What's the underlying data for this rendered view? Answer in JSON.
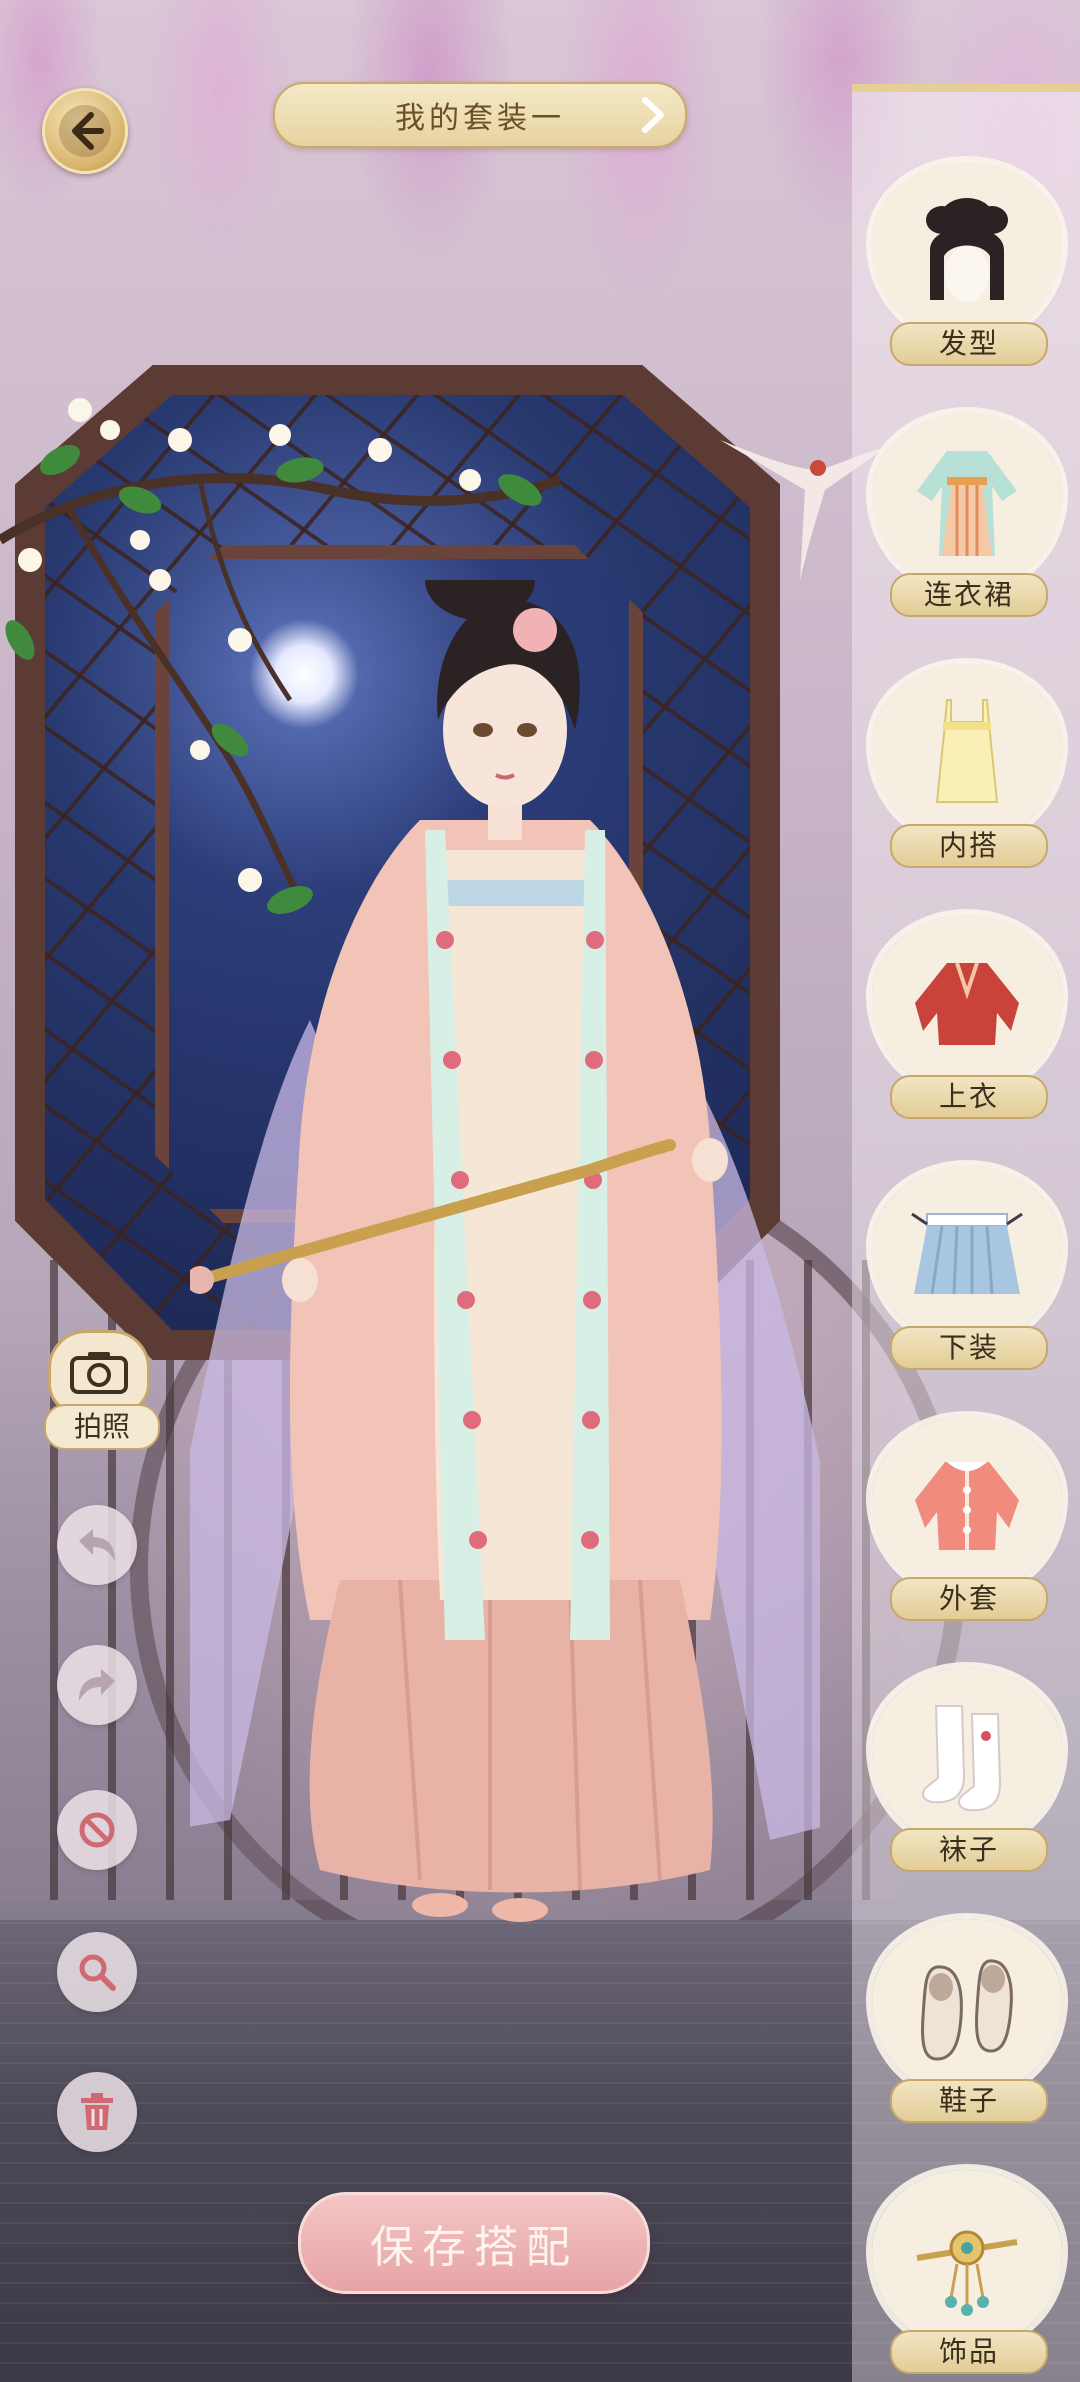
{
  "header": {
    "title": "我的套装一",
    "back_icon": "back-arrow-icon",
    "next_icon": "chevron-right-icon"
  },
  "left_tools": {
    "camera_label": "拍照",
    "camera_icon": "camera-icon",
    "undo_icon": "undo-icon",
    "redo_icon": "redo-icon",
    "clear_icon": "ban-icon",
    "zoom_icon": "magnifier-icon",
    "delete_icon": "trash-icon"
  },
  "save_button": {
    "label": "保存搭配"
  },
  "categories": [
    {
      "label": "发型",
      "icon": "hairstyle-icon"
    },
    {
      "label": "连衣裙",
      "icon": "dress-icon"
    },
    {
      "label": "内搭",
      "icon": "inner-top-icon"
    },
    {
      "label": "上衣",
      "icon": "jacket-icon"
    },
    {
      "label": "下装",
      "icon": "skirt-icon"
    },
    {
      "label": "外套",
      "icon": "coat-icon"
    },
    {
      "label": "袜子",
      "icon": "socks-icon"
    },
    {
      "label": "鞋子",
      "icon": "shoes-icon"
    },
    {
      "label": "饰品",
      "icon": "hairpin-icon"
    }
  ],
  "colors": {
    "gold": "#d7b26b",
    "cream": "#f6eee0",
    "pink_button": "#e7a4a6",
    "wood": "#5b3b33"
  }
}
